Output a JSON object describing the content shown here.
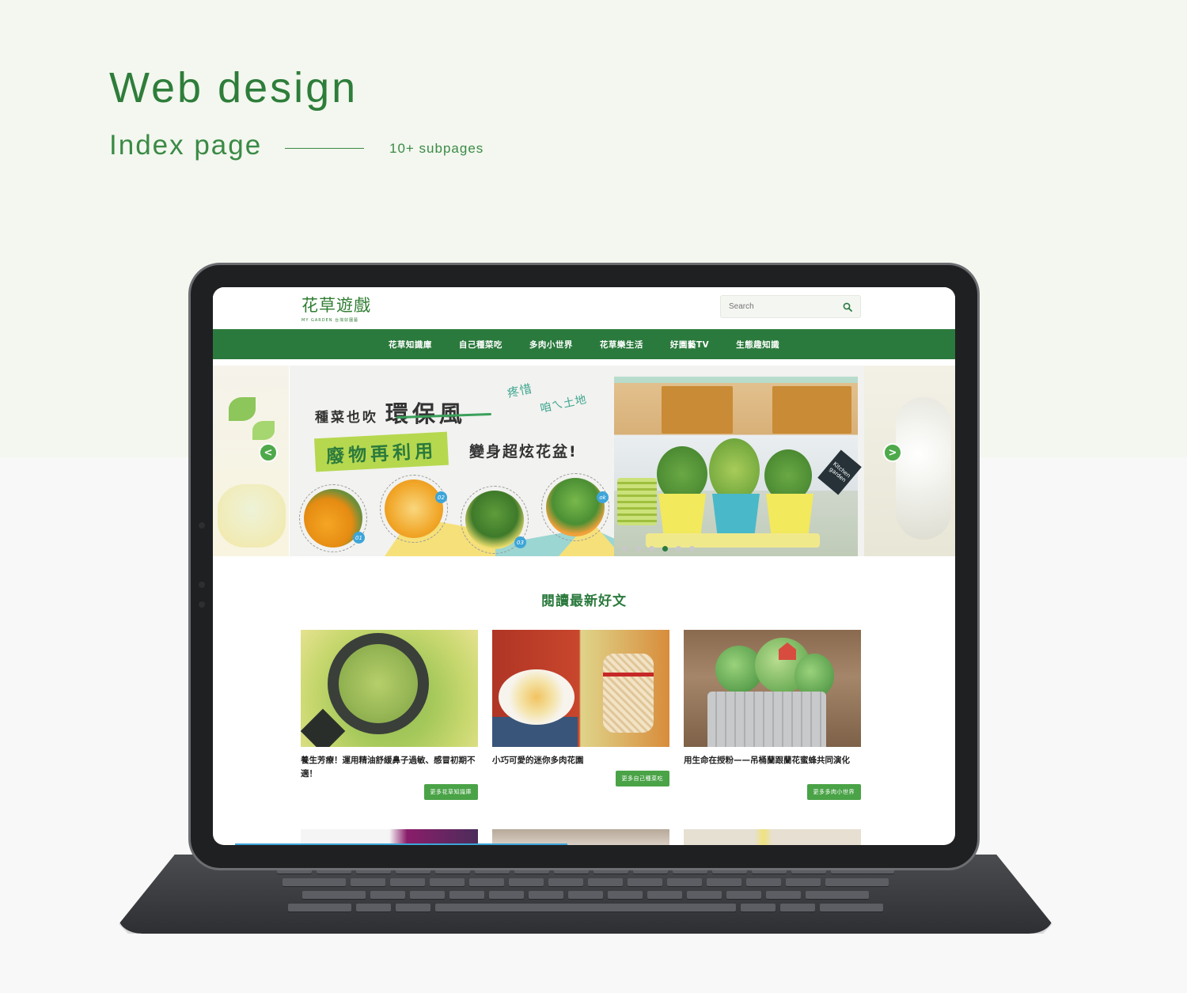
{
  "presentation": {
    "title": "Web design",
    "subtitle": "Index page",
    "subpage_count": "10+ subpages"
  },
  "site": {
    "logo": {
      "name": "花草遊戲",
      "tagline": "MY GARDEN 台灣好園藝"
    },
    "search": {
      "placeholder": "Search",
      "value": ""
    },
    "nav": [
      {
        "label": "花草知識庫"
      },
      {
        "label": "自己種菜吃"
      },
      {
        "label": "多肉小世界"
      },
      {
        "label": "花草樂生活"
      },
      {
        "label": "好園藝TV"
      },
      {
        "label": "生態趣知識"
      }
    ],
    "hero": {
      "line1_a": "種菜也吹",
      "line1_b": "環保風",
      "note_a": "疼惜",
      "note_b": "咱ㄟ土地",
      "tag": "廢物再利用",
      "line2": "變身超炫花盆!",
      "steps": [
        "01",
        "02",
        "03",
        "ok"
      ],
      "photo_sign": "Kitchen garden",
      "prev_label": "<",
      "next_label": ">",
      "slide_count": 6,
      "active_slide": 4
    },
    "latest": {
      "title": "閱讀最新好文",
      "articles": [
        {
          "title": "養生芳療！運用精油舒緩鼻子過敏、感冒初期不適！",
          "button": "更多花草知識庫"
        },
        {
          "title": "小巧可愛的迷你多肉花園",
          "button": "更多自己種菜吃"
        },
        {
          "title": "用生命在授粉——吊桶蘭跟蘭花蜜蜂共同演化",
          "button": "更多多肉小世界"
        }
      ]
    }
  },
  "colors": {
    "brand_green": "#2b7a3d",
    "button_green": "#4aa347",
    "heading_green": "#2e7d3a"
  }
}
